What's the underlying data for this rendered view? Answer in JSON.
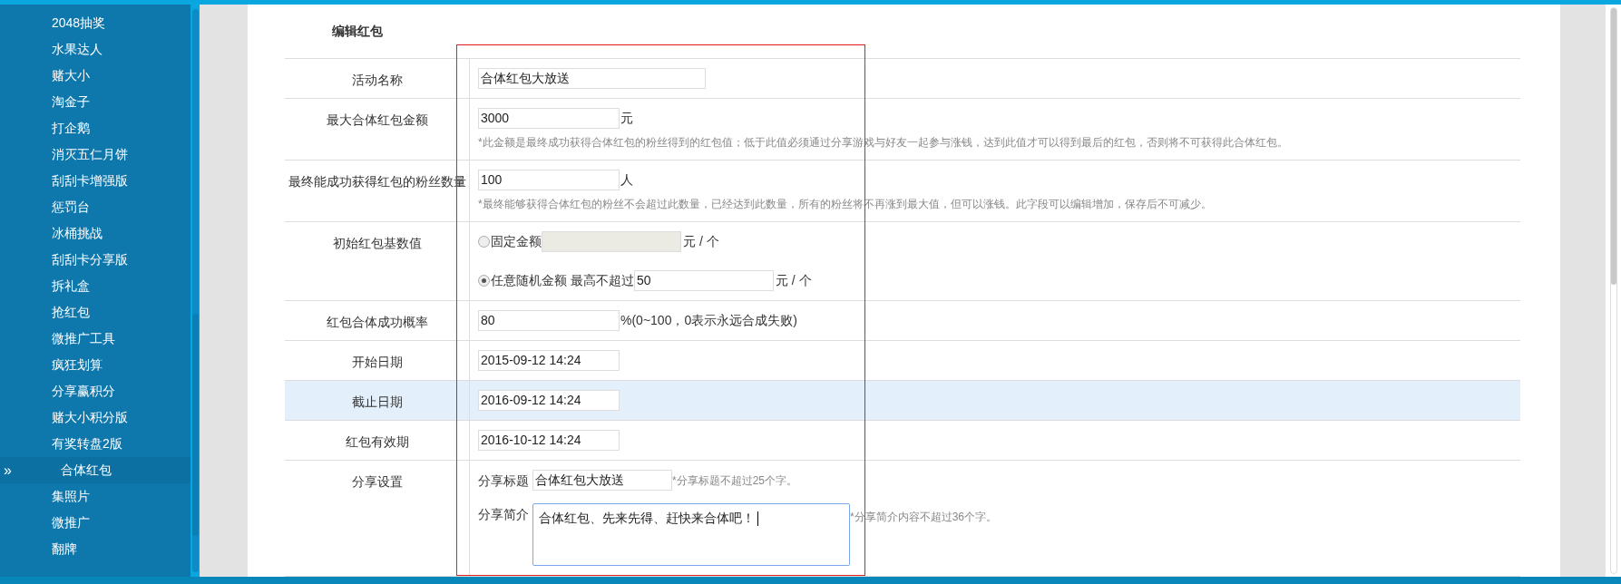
{
  "sidebar": {
    "items": [
      {
        "label": "2048抽奖",
        "selected": false
      },
      {
        "label": "水果达人",
        "selected": false
      },
      {
        "label": "赌大小",
        "selected": false
      },
      {
        "label": "淘金子",
        "selected": false
      },
      {
        "label": "打企鹅",
        "selected": false
      },
      {
        "label": "消灭五仁月饼",
        "selected": false
      },
      {
        "label": "刮刮卡增强版",
        "selected": false
      },
      {
        "label": "惩罚台",
        "selected": false
      },
      {
        "label": "冰桶挑战",
        "selected": false
      },
      {
        "label": "刮刮卡分享版",
        "selected": false
      },
      {
        "label": "拆礼盒",
        "selected": false
      },
      {
        "label": "抢红包",
        "selected": false
      },
      {
        "label": "微推广工具",
        "selected": false
      },
      {
        "label": "疯狂划算",
        "selected": false
      },
      {
        "label": "分享赢积分",
        "selected": false
      },
      {
        "label": "赌大小积分版",
        "selected": false
      },
      {
        "label": "有奖转盘2版",
        "selected": false
      },
      {
        "label": "合体红包",
        "selected": true,
        "marker": "»"
      },
      {
        "label": "集照片",
        "selected": false
      },
      {
        "label": "微推广",
        "selected": false
      },
      {
        "label": "翻牌",
        "selected": false
      }
    ]
  },
  "form": {
    "title": "编辑红包",
    "rows": [
      {
        "kind": "input",
        "label": "活动名称",
        "value": "合体红包大放送",
        "highlighted": false
      },
      {
        "kind": "input",
        "label": "最大合体红包金额",
        "value": "3000",
        "suffix": "元",
        "hint": "*此金额是最终成功获得合体红包的粉丝得到的红包值；低于此值必须通过分享游戏与好友一起参与涨钱，达到此值才可以得到最后的红包，否则将不可获得此合体红包。",
        "highlighted": false
      },
      {
        "kind": "input",
        "label": "最终能成功获得红包的粉丝数量",
        "value": "100",
        "suffix": "人",
        "hint": "*最终能够获得合体红包的粉丝不会超过此数量，已经达到此数量，所有的粉丝将不再涨到最大值，但可以涨钱。此字段可以编辑增加，保存后不可减少。",
        "highlighted": false
      },
      {
        "kind": "radio",
        "label": "初始红包基数值",
        "highlighted": false,
        "options": [
          {
            "label": "固定金额",
            "selected": false,
            "disabled": true,
            "suffix": "元 / 个"
          },
          {
            "label": "任意随机金额 最高不超过",
            "selected": true,
            "disabled": false,
            "value": "50",
            "suffix": "元 / 个"
          }
        ]
      },
      {
        "kind": "input",
        "label": "红包合体成功概率",
        "value": "80",
        "suffix": "%(0~100，0表示永远合成失败)",
        "highlighted": false
      },
      {
        "kind": "input",
        "label": "开始日期",
        "value": "2015-09-12 14:24",
        "highlighted": false
      },
      {
        "kind": "input",
        "label": "截止日期",
        "value": "2016-09-12 14:24",
        "highlighted": true
      },
      {
        "kind": "input",
        "label": "红包有效期",
        "value": "2016-10-12 14:24",
        "highlighted": false
      },
      {
        "kind": "share",
        "label": "分享设置",
        "highlighted": false,
        "fields": [
          {
            "kind": "input",
            "label": "分享标题",
            "value": "合体红包大放送",
            "hint": "*分享标题不超过25个字。",
            "focused": false
          },
          {
            "kind": "textarea",
            "label": "分享简介",
            "value": "合体红包、先来先得、赶快来合体吧！",
            "hint": "*分享简介内容不超过36个字。",
            "focused": true
          }
        ]
      }
    ]
  }
}
